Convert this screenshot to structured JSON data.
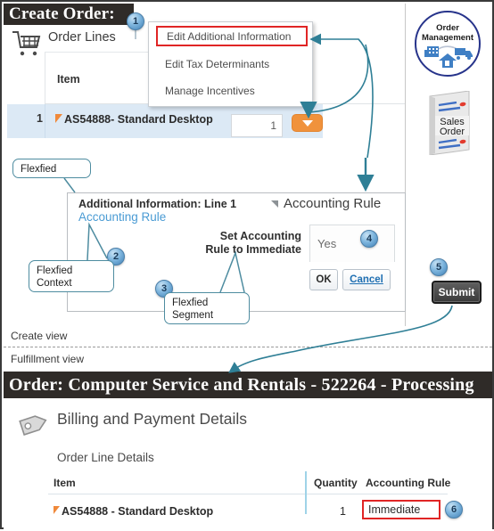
{
  "banners": {
    "create_order": "Create Order:",
    "order_status": "Order: Computer Service and Rentals - 522264 - Processing"
  },
  "top_section": {
    "section_label": "Order Lines",
    "cart_icon": "shopping-cart-icon",
    "table": {
      "columns": [
        "Item"
      ],
      "rows": [
        {
          "line_number": "1",
          "item": "AS54888- Standard Desktop",
          "quantity": "1",
          "action_icon": "chevron-down-icon"
        }
      ]
    }
  },
  "dropdown_menu": {
    "items": [
      {
        "label": "Edit Additional Information",
        "highlighted": true
      },
      {
        "label": "Edit Tax Determinants",
        "highlighted": false
      },
      {
        "label": "Manage Incentives",
        "highlighted": false
      }
    ]
  },
  "flexfield_dialog": {
    "title": "Additional Information: Line 1",
    "context_link": "Accounting Rule",
    "section_header": "Accounting Rule",
    "disclosure_icon": "triangle-collapse-icon",
    "field_label": "Set Accounting\nRule to Immediate",
    "field_value": "Yes",
    "ok_label": "OK",
    "cancel_label": "Cancel"
  },
  "callouts": {
    "bubbles": [
      {
        "id": "flexfied",
        "text": "Flexfied"
      },
      {
        "id": "flexfied-context",
        "text": "Flexfied\nContext"
      },
      {
        "id": "flexfied-segment",
        "text": "Flexfied\nSegment"
      }
    ],
    "markers": [
      "1",
      "2",
      "3",
      "4",
      "5",
      "6"
    ]
  },
  "submit": {
    "label": "Submit"
  },
  "views": {
    "create_view": "Create view",
    "fulfillment_view": "Fulfillment view"
  },
  "bottom_section": {
    "tag_icon": "tag-icon",
    "title": "Billing and Payment Details",
    "subtitle": "Order Line Details",
    "table": {
      "columns": [
        "Item",
        "Quantity",
        "Accounting Rule"
      ],
      "rows": [
        {
          "item": "AS54888 - Standard Desktop",
          "quantity": "1",
          "accounting_rule": "Immediate"
        }
      ]
    }
  },
  "right_rail": {
    "logo": {
      "icon": "order-management-logo",
      "line1": "Order",
      "line2": "Management"
    },
    "document": {
      "icon": "sales-order-document-icon",
      "line1": "Sales",
      "line2": "Order"
    }
  },
  "colors": {
    "accent_orange": "#f0923c",
    "highlight_red": "#e02525",
    "link_blue": "#4a9bd4",
    "callout_teal": "#4e8ca0",
    "banner_dark": "#2f2b28",
    "row_highlight": "#dce9f5"
  }
}
